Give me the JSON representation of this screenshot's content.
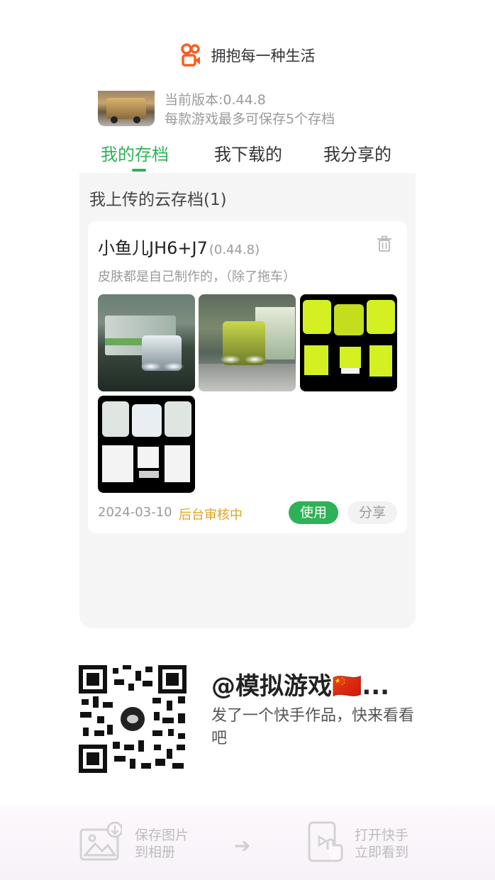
{
  "header": {
    "title": "拥抱每一种生活",
    "brand_color": "#ff5b1f"
  },
  "game": {
    "version_line": "当前版本:0.44.8",
    "limit_line": "每款游戏最多可保存5个存档"
  },
  "tabs": [
    {
      "label": "我的存档",
      "active": true
    },
    {
      "label": "我下载的",
      "active": false
    },
    {
      "label": "我分享的",
      "active": false
    }
  ],
  "accent_color": "#2fb157",
  "section": {
    "title": "我上传的云存档(1)"
  },
  "card": {
    "title": "小鱼儿JH6+J7",
    "version": "(0.44.8)",
    "description": "皮肤都是自己制作的，（除了拖车）",
    "date": "2024-03-10",
    "status": "后台审核中",
    "status_color": "#e0a321",
    "use_label": "使用",
    "share_label": "分享",
    "image_count": 4
  },
  "share": {
    "title": "@模拟游戏🇨🇳...",
    "description": "发了一个快手作品，快来看看吧"
  },
  "bottom": {
    "save_label_1": "保存图片",
    "save_label_2": "到相册",
    "open_label_1": "打开快手",
    "open_label_2": "立即看到"
  }
}
